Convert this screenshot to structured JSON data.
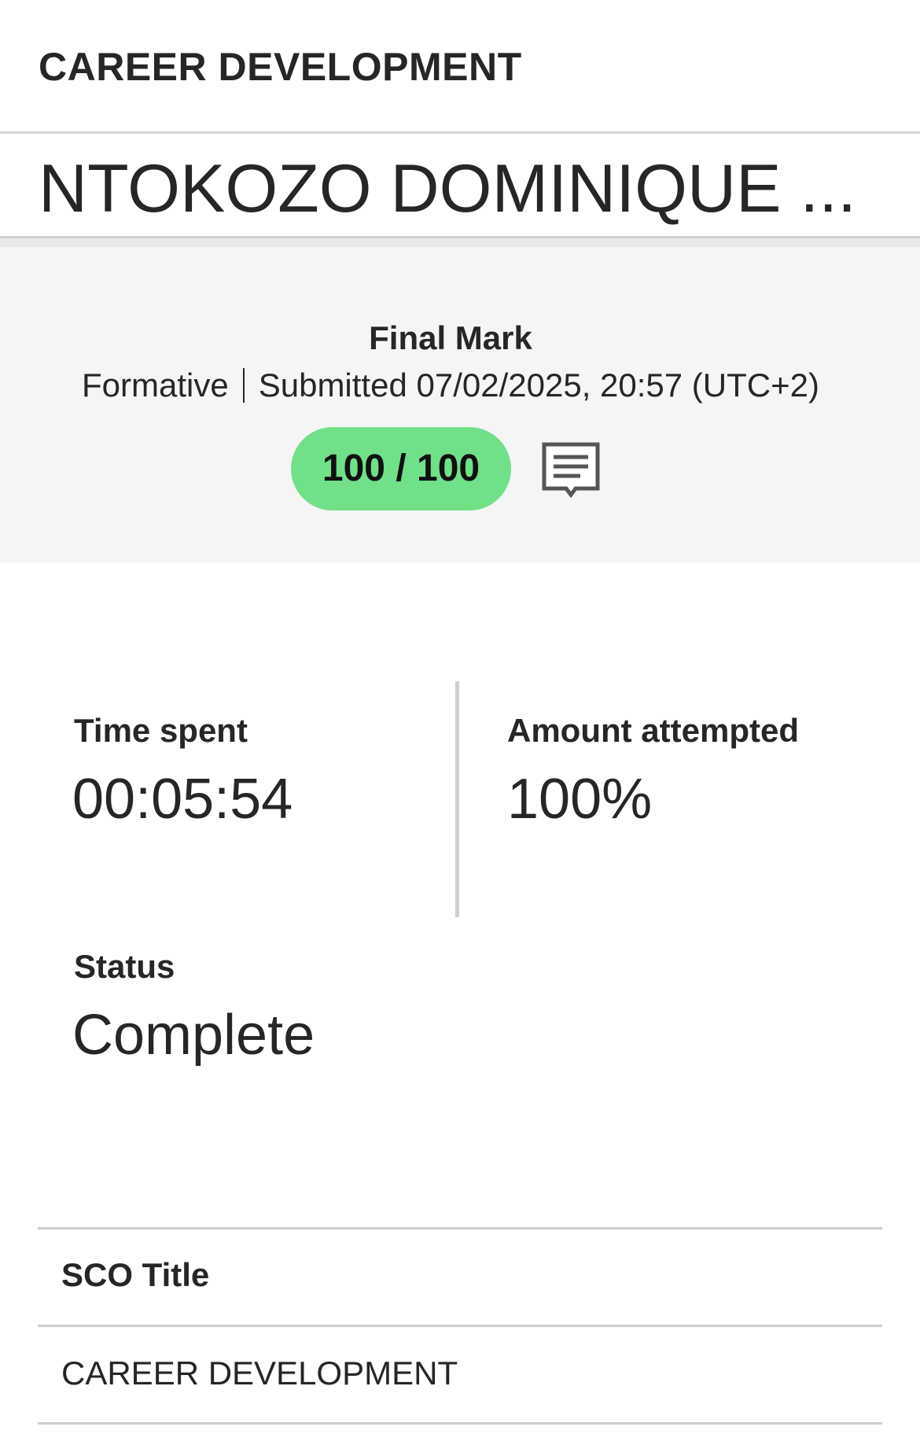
{
  "header": {
    "course_title": "CAREER DEVELOPMENT",
    "user_name": "NTOKOZO DOMINIQUE ..."
  },
  "summary": {
    "final_mark_label": "Final Mark",
    "assessment_type": "Formative",
    "submitted_text": "Submitted 07/02/2025, 20:57 (UTC+2)",
    "score": "100 / 100",
    "score_color": "#72df89",
    "feedback_icon": "comment-icon"
  },
  "stats": {
    "time_spent_label": "Time spent",
    "time_spent_value": "00:05:54",
    "amount_attempted_label": "Amount attempted",
    "amount_attempted_value": "100%",
    "status_label": "Status",
    "status_value": "Complete"
  },
  "sco_table": {
    "header": "SCO Title",
    "rows": [
      {
        "title": "CAREER DEVELOPMENT"
      }
    ]
  }
}
